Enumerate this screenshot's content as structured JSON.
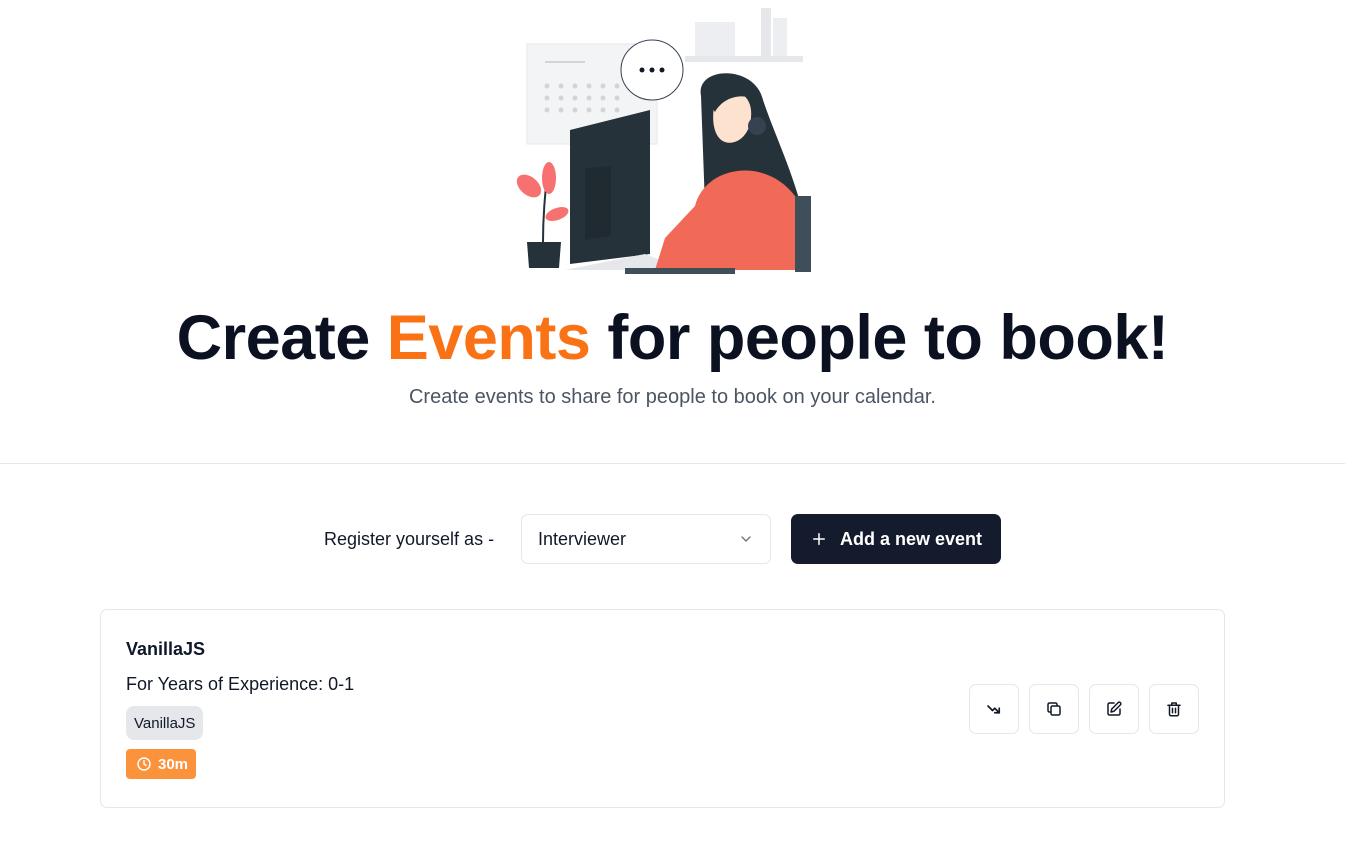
{
  "hero": {
    "title_prefix": "Create",
    "title_accent": "Events",
    "title_suffix": "for people to book!",
    "subtitle": "Create events to share for people to book on your calendar.",
    "accent_color": "#f97316"
  },
  "register": {
    "label": "Register yourself as -",
    "selected_role": "Interviewer"
  },
  "add_event": {
    "label": "Add a new event",
    "icon": "plus-icon"
  },
  "events": [
    {
      "name": "VanillaJS",
      "experience": "For Years of Experience: 0-1",
      "tag": "VanillaJS",
      "duration": "30m",
      "actions": [
        "trending-icon",
        "copy-icon",
        "edit-icon",
        "trash-icon"
      ]
    }
  ],
  "colors": {
    "primary_button": "#131b2c",
    "duration_badge": "#fb923c",
    "tag_background": "#e5e7eb"
  }
}
